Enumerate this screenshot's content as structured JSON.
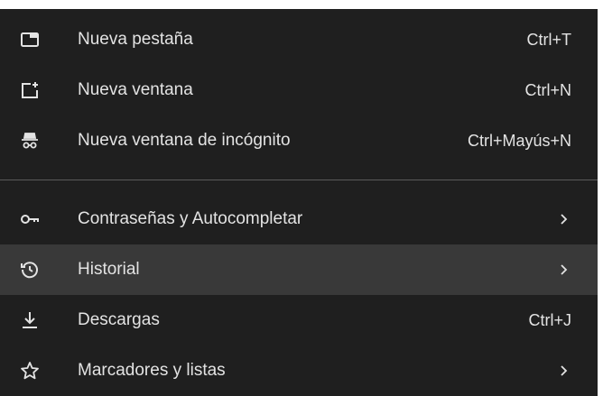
{
  "menu": {
    "items": [
      {
        "label": "Nueva pestaña",
        "shortcut": "Ctrl+T",
        "icon": "new-tab-icon"
      },
      {
        "label": "Nueva ventana",
        "shortcut": "Ctrl+N",
        "icon": "new-window-icon"
      },
      {
        "label": "Nueva ventana de incógnito",
        "shortcut": "Ctrl+Mayús+N",
        "icon": "incognito-icon"
      },
      {
        "label": "Contraseñas y Autocompletar",
        "submenu": true,
        "icon": "key-icon"
      },
      {
        "label": "Historial",
        "submenu": true,
        "icon": "history-icon",
        "highlighted": true
      },
      {
        "label": "Descargas",
        "shortcut": "Ctrl+J",
        "icon": "download-icon"
      },
      {
        "label": "Marcadores y listas",
        "submenu": true,
        "icon": "star-icon"
      }
    ]
  },
  "colors": {
    "menu_background": "#1f1f1f",
    "highlight_background": "#393939",
    "text": "#e3e3e3",
    "divider": "#5a5a5a"
  }
}
